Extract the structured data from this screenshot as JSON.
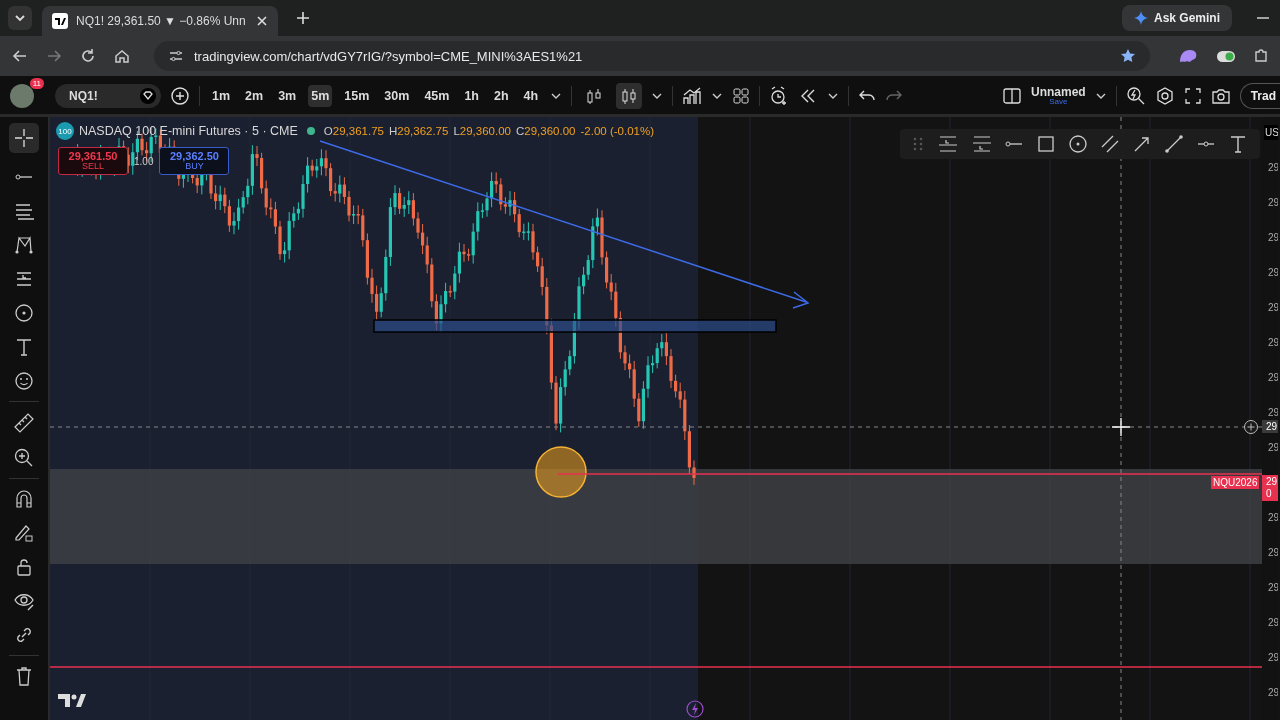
{
  "browser": {
    "tab": {
      "title": "NQ1! 29,361.50 ▼ −0.86% Unn"
    },
    "gemini_button": "Ask Gemini",
    "address": "tradingview.com/chart/vdGY7rIG/?symbol=CME_MINI%3AES1%21"
  },
  "toolbar": {
    "notifications": "11",
    "symbol": "NQ1!",
    "intervals": [
      {
        "label": "1m",
        "selected": false
      },
      {
        "label": "2m",
        "selected": false
      },
      {
        "label": "3m",
        "selected": false
      },
      {
        "label": "5m",
        "selected": true
      },
      {
        "label": "15m",
        "selected": false
      },
      {
        "label": "30m",
        "selected": false
      },
      {
        "label": "45m",
        "selected": false
      },
      {
        "label": "1h",
        "selected": false
      },
      {
        "label": "2h",
        "selected": false
      },
      {
        "label": "4h",
        "selected": false
      }
    ],
    "chart_types": [
      {
        "kind": "bars",
        "selected": false
      },
      {
        "kind": "candles",
        "selected": true
      }
    ],
    "layout": {
      "name": "Unnamed",
      "action": "Save"
    },
    "trade_button": "Trad"
  },
  "legend": {
    "badge": "100",
    "title": "NASDAQ 100 E-mini Futures · 5 · CME",
    "ohlc": [
      {
        "label": "O",
        "value": "29,361.75"
      },
      {
        "label": "H",
        "value": "29,362.75"
      },
      {
        "label": "L",
        "value": "29,360.00"
      },
      {
        "label": "C",
        "value": "29,360.00"
      }
    ],
    "change": "-2.00 (-0.01%)",
    "sell": {
      "price": "29,361.50",
      "label": "SELL"
    },
    "quantity": "1.00",
    "buy": {
      "price": "29,362.50",
      "label": "BUY"
    }
  },
  "contract_label": "NQU2026",
  "price_axis": {
    "currency": "US",
    "ticks": [
      "29",
      "29",
      "29",
      "29",
      "29",
      "29",
      "29",
      "29",
      "29",
      "29",
      "29",
      "29",
      "29",
      "29",
      "29"
    ],
    "crosshair_label": "29",
    "last_price": [
      "29",
      "0"
    ]
  }
}
